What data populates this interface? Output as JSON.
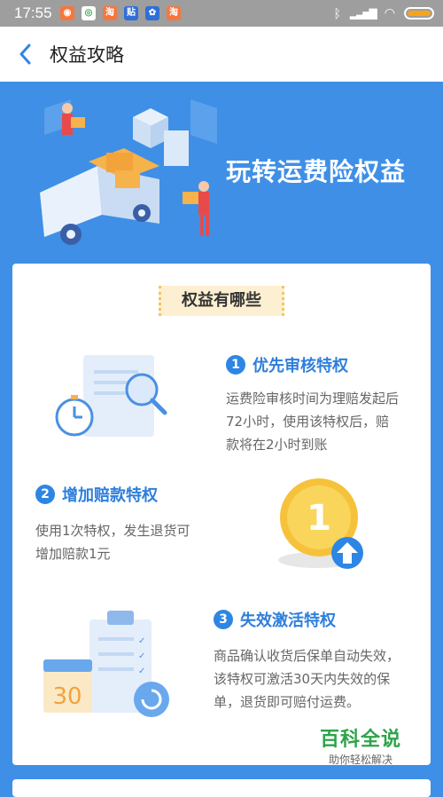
{
  "status": {
    "time": "17:55"
  },
  "header": {
    "title": "权益攻略"
  },
  "hero": {
    "title": "玩转运费险权益"
  },
  "section_tag": "权益有哪些",
  "items": [
    {
      "number": "1",
      "title": "优先审核特权",
      "desc_lines": [
        "运费险审核时间为理赔发起后",
        "72小时，使用该特权后，赔",
        "款将在2小时到账"
      ]
    },
    {
      "number": "2",
      "title": "增加赔款特权",
      "desc_lines": [
        "使用1次特权，发生退货可",
        "增加赔款1元"
      ]
    },
    {
      "number": "3",
      "title": "失效激活特权",
      "desc_lines": [
        "商品确认收货后保单自动失效，",
        "该特权可激活30天内失效的保",
        "单，退货即可赔付运费。"
      ]
    }
  ],
  "illustrations": {
    "coin_value": "1",
    "calendar_value": "30"
  },
  "watermark": {
    "main": "百科全说",
    "sub": "助你轻松解决"
  }
}
